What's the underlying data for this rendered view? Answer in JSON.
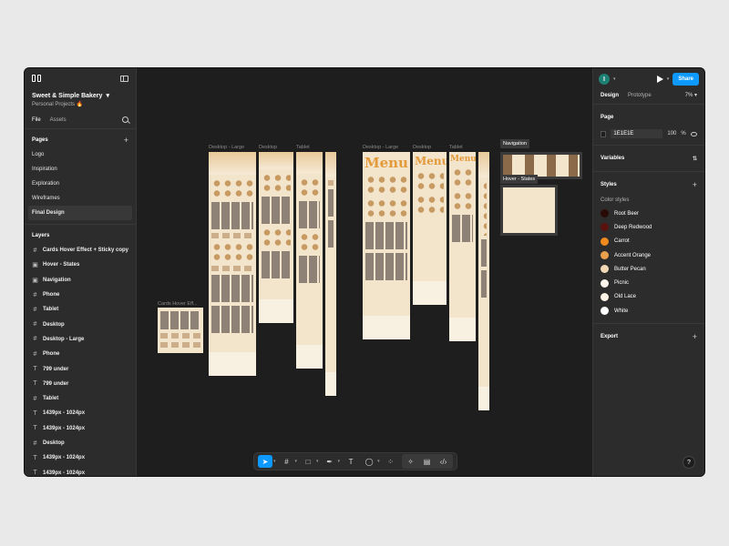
{
  "file": {
    "title": "Sweet & Simple Bakery",
    "subtitle": "Personal Projects 🔥"
  },
  "left_tabs": {
    "file": "File",
    "assets": "Assets"
  },
  "pages": {
    "heading": "Pages",
    "items": [
      "Logo",
      "Inspiration",
      "Exploration",
      "Wireframes",
      "Final Design"
    ]
  },
  "layers": {
    "heading": "Layers",
    "items": [
      {
        "icon": "#",
        "label": "Cards Hover Effect + Sticky copy"
      },
      {
        "icon": "▣",
        "label": "Hover - States"
      },
      {
        "icon": "▣",
        "label": "Navigation"
      },
      {
        "icon": "#",
        "label": "Phone"
      },
      {
        "icon": "#",
        "label": "Tablet"
      },
      {
        "icon": "#",
        "label": "Desktop"
      },
      {
        "icon": "#",
        "label": "Desktop - Large"
      },
      {
        "icon": "#",
        "label": "Phone"
      },
      {
        "icon": "T",
        "label": "799 under"
      },
      {
        "icon": "T",
        "label": "799 under"
      },
      {
        "icon": "#",
        "label": "Tablet"
      },
      {
        "icon": "T",
        "label": "1439px - 1024px"
      },
      {
        "icon": "T",
        "label": "1439px - 1024px"
      },
      {
        "icon": "#",
        "label": "Desktop"
      },
      {
        "icon": "T",
        "label": "1439px - 1024px"
      },
      {
        "icon": "T",
        "label": "1439px - 1024px"
      }
    ]
  },
  "canvas": {
    "labels": {
      "cards_hover": "Cards Hover Eff...",
      "desktop_large_1": "Desktop - Large",
      "desktop_1": "Desktop",
      "tablet_1": "Tablet",
      "desktop_large_2": "Desktop - Large",
      "desktop_2": "Desktop",
      "tablet_2": "Tablet",
      "navigation": "Navigation",
      "hover_states": "Hover - States"
    },
    "menu_word": "Menu"
  },
  "toolbar": {
    "tools": [
      "move-tool",
      "frame-tool",
      "shape-tool",
      "pen-tool",
      "text-tool",
      "comment-tool",
      "actions-tool"
    ],
    "text_glyph": "T"
  },
  "right": {
    "share": "Share",
    "tabs": {
      "design": "Design",
      "prototype": "Prototype"
    },
    "zoom": "7%",
    "page": {
      "heading": "Page",
      "hex": "1E1E1E",
      "opacity": "100",
      "pct": "%"
    },
    "variables": "Variables",
    "styles": "Styles",
    "color_styles_heading": "Color styles",
    "color_styles": [
      {
        "name": "Root Beer",
        "color": "#2a0a06"
      },
      {
        "name": "Deep Redwood",
        "color": "#5a120f"
      },
      {
        "name": "Carrot",
        "color": "#ef8a1e"
      },
      {
        "name": "Accent Orange",
        "color": "#e9a04c"
      },
      {
        "name": "Butter Pecan",
        "color": "#f3d9b3"
      },
      {
        "name": "Picnic",
        "color": "#fbf5ec"
      },
      {
        "name": "Old Lace",
        "color": "#fdf3e6"
      },
      {
        "name": "White",
        "color": "#ffffff"
      }
    ],
    "export": "Export",
    "help": "?"
  }
}
